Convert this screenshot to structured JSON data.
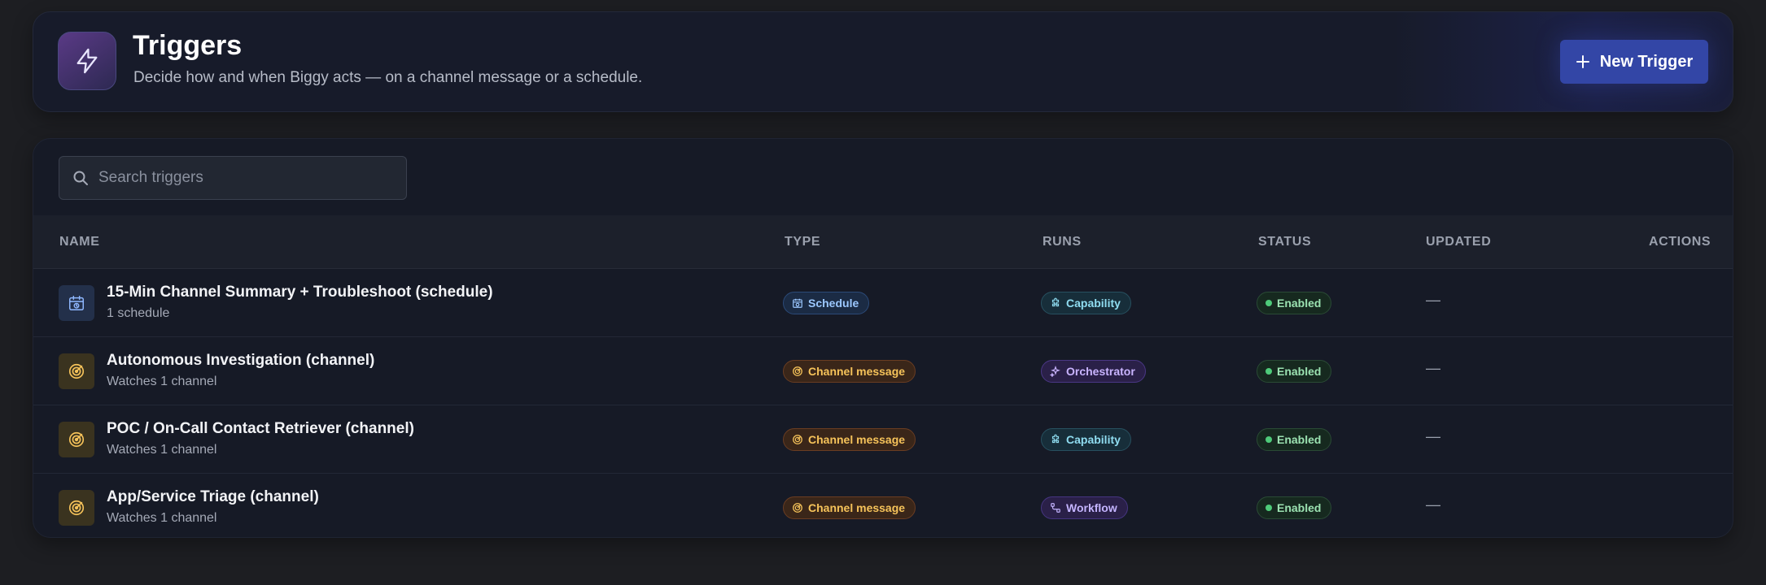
{
  "header": {
    "title": "Triggers",
    "subtitle": "Decide how and when Biggy acts — on a channel message or a schedule.",
    "new_button_label": "New Trigger"
  },
  "search": {
    "placeholder": "Search triggers",
    "value": ""
  },
  "table": {
    "columns": [
      "NAME",
      "TYPE",
      "RUNS",
      "STATUS",
      "UPDATED",
      "ACTIONS"
    ],
    "rows": [
      {
        "name": "15-Min Channel Summary + Troubleshoot (schedule)",
        "sub": "1 schedule",
        "icon": "calendar-clock-icon",
        "type": "Schedule",
        "runs": "Capability",
        "status": "Enabled",
        "updated": "—"
      },
      {
        "name": "Autonomous Investigation (channel)",
        "sub": "Watches 1 channel",
        "icon": "radar-icon",
        "type": "Channel message",
        "runs": "Orchestrator",
        "status": "Enabled",
        "updated": "—"
      },
      {
        "name": "POC / On-Call Contact Retriever (channel)",
        "sub": "Watches 1 channel",
        "icon": "radar-icon",
        "type": "Channel message",
        "runs": "Capability",
        "status": "Enabled",
        "updated": "—"
      },
      {
        "name": "App/Service Triage (channel)",
        "sub": "Watches 1 channel",
        "icon": "radar-icon",
        "type": "Channel message",
        "runs": "Workflow",
        "status": "Enabled",
        "updated": "—"
      }
    ]
  },
  "colors": {
    "accent": "#3346a6",
    "schedule": "#9cc8ff",
    "channel": "#f6c35a",
    "capability": "#8fdcf0",
    "orchestrator": "#c9b4ff",
    "enabled": "#4ecb7a"
  }
}
